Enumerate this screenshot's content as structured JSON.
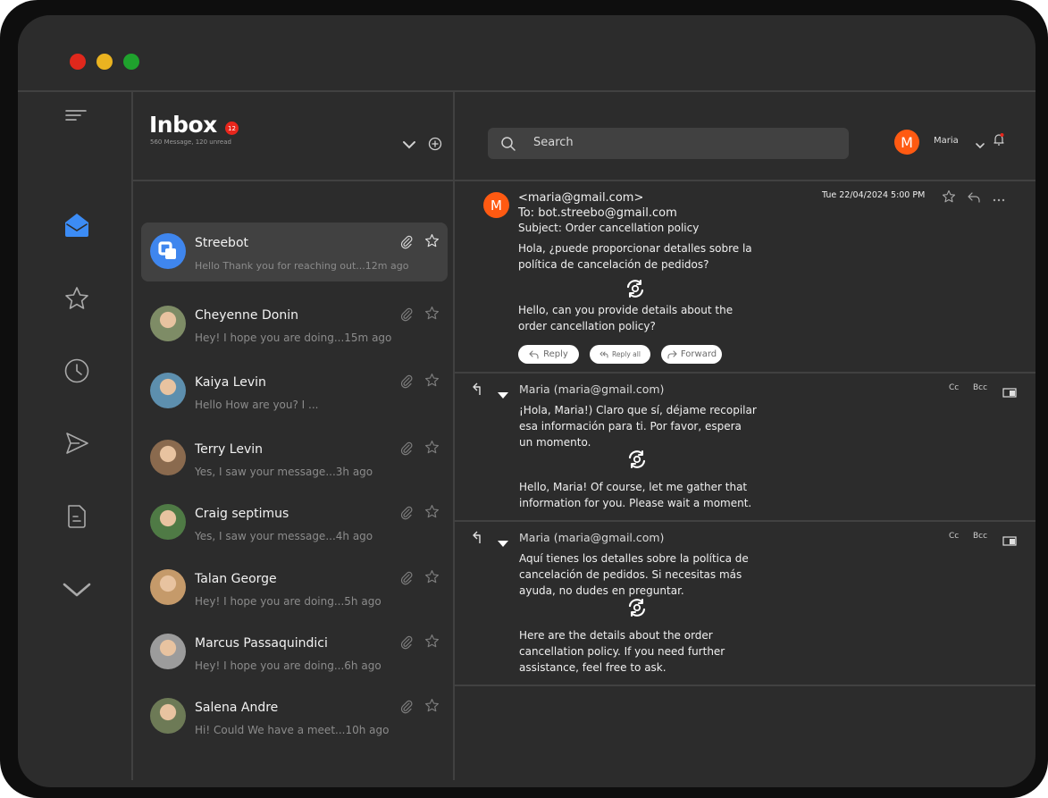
{
  "window": {
    "controls": [
      "#e0281c",
      "#eab320",
      "#1fa22d"
    ]
  },
  "rail": {
    "icons": [
      "menu-icon",
      "mail-icon",
      "star-icon",
      "clock-icon",
      "send-icon",
      "document-icon",
      "chevron-down-icon"
    ],
    "active_color": "#3c8cf5"
  },
  "inbox": {
    "title": "Inbox",
    "badge": "12",
    "subtitle": "560 Message, 120 unread"
  },
  "messages": [
    {
      "name": "Streebot",
      "preview": "Hello Thank you for reaching out...12m ago",
      "active": true,
      "avatar_color": "#3f86ee"
    },
    {
      "name": "Cheyenne Donin",
      "preview": "Hey! I hope you are doing...15m ago",
      "avatar_color": "#7e8c66"
    },
    {
      "name": "Kaiya Levin",
      "preview": "Hello How are you? I ...",
      "avatar_color": "#5d8fae"
    },
    {
      "name": "Terry Levin",
      "preview": "Yes, I saw your message...3h ago",
      "avatar_color": "#8a6a4e"
    },
    {
      "name": "Craig septimus",
      "preview": "Yes, I saw your message...4h ago",
      "avatar_color": "#4f7a45"
    },
    {
      "name": "Talan George",
      "preview": "Hey! I hope you are doing...5h ago",
      "avatar_color": "#c59a6a"
    },
    {
      "name": "Marcus Passaquindici",
      "preview": "Hey! I hope you are doing...6h ago",
      "avatar_color": "#9c9c9c"
    },
    {
      "name": "Salena Andre",
      "preview": "Hi! Could We have a meet...10h ago",
      "avatar_color": "#6d7a56"
    }
  ],
  "topbar": {
    "search_label": "Search",
    "user_initial": "M",
    "user_name": "Maria",
    "accent": "#ff5a12"
  },
  "thread": {
    "initial": "M",
    "from": "<maria@gmail.com>",
    "to": "To: bot.streebo@gmail.com",
    "subject_label": "Subject:",
    "subject": "Order cancellation policy",
    "timestamp": "Tue 22/04/2024 5:00 PM",
    "original_lines": [
      "Hola, ¿puede proporcionar detalles sobre la",
      "política de cancelación de pedidos?"
    ],
    "translated_lines": [
      "Hello, can you provide details about the",
      "order cancellation policy?"
    ],
    "buttons": {
      "reply": "Reply",
      "reply_all": "Reply all",
      "forward": "Forward"
    },
    "replies": [
      {
        "sender": "Maria (maria@gmail.com)",
        "cc": "Cc",
        "bcc": "Bcc",
        "original_lines": [
          "¡Hola, Maria!) Claro que sí, déjame recopilar",
          "esa información para ti. Por favor, espera",
          "un momento."
        ],
        "translated_lines": [
          "Hello, Maria! Of course, let me gather that",
          "information for you. Please wait a moment."
        ]
      },
      {
        "sender": "Maria (maria@gmail.com)",
        "cc": "Cc",
        "bcc": "Bcc",
        "original_lines": [
          "Aquí tienes los detalles sobre la política de",
          "cancelación de pedidos. Si necesitas más",
          "ayuda, no dudes en preguntar."
        ],
        "translated_lines": [
          "Here are the details about the order",
          "cancellation policy. If you need further",
          "assistance, feel free to ask."
        ]
      }
    ]
  }
}
